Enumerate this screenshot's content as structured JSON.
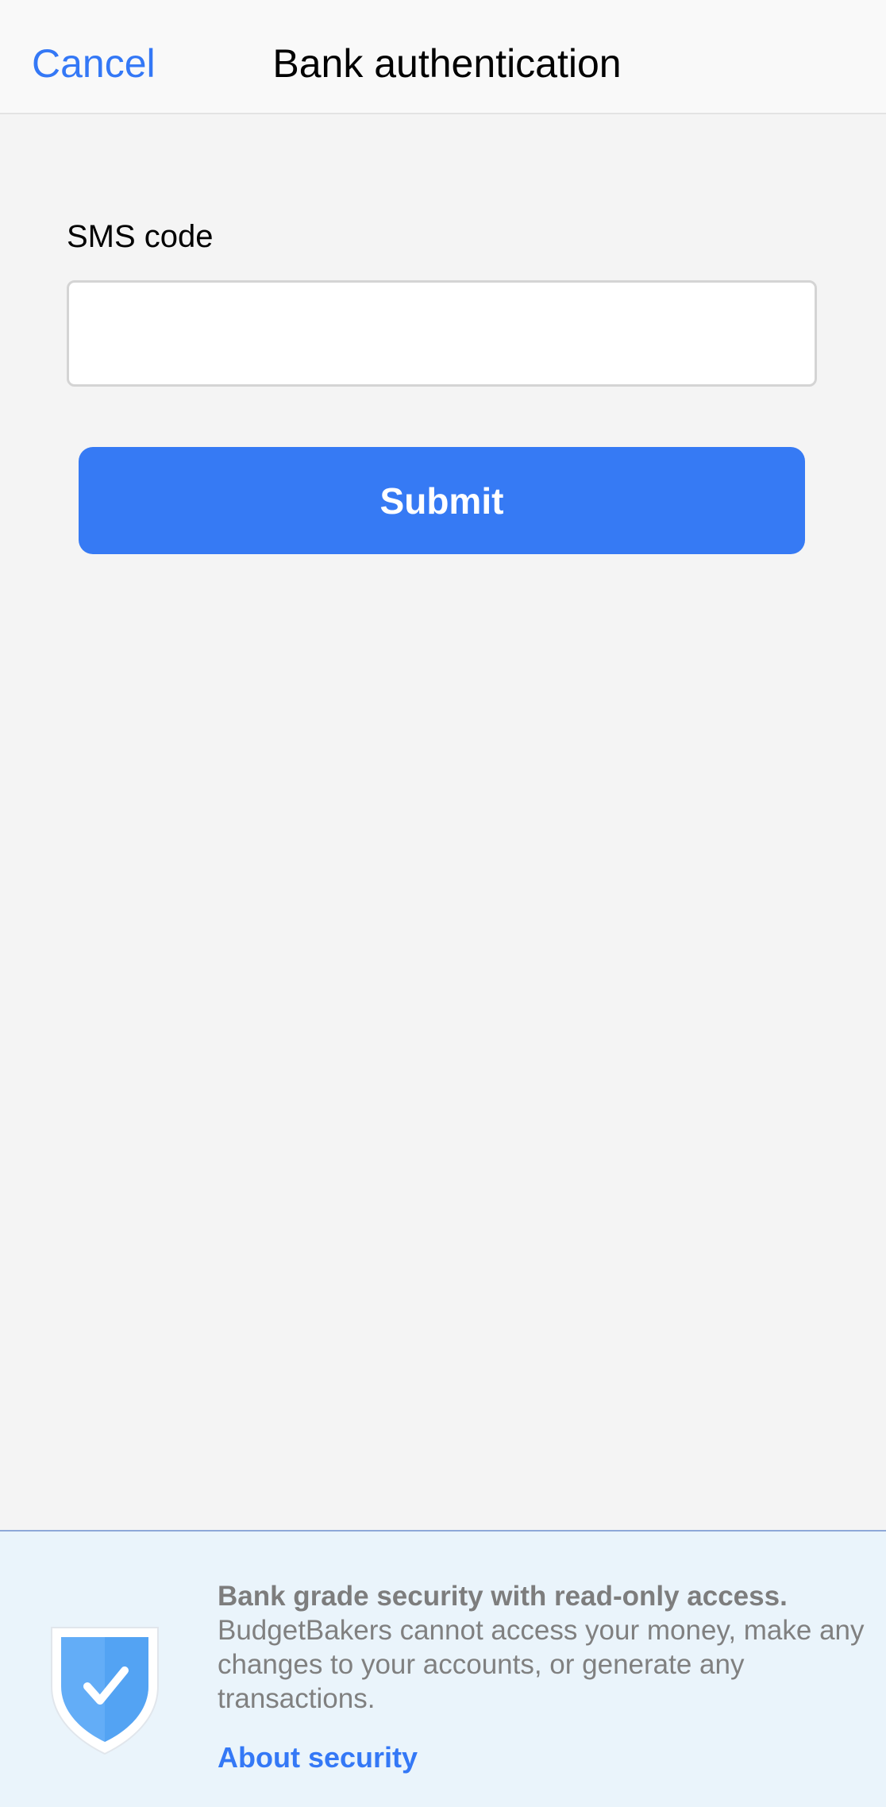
{
  "nav": {
    "cancel_label": "Cancel",
    "title": "Bank authentication"
  },
  "form": {
    "sms_label": "SMS code",
    "sms_value": "",
    "sms_placeholder": "",
    "submit_label": "Submit"
  },
  "security": {
    "icon": "shield-check-icon",
    "heading": "Bank grade security with read-only access.",
    "body": "BudgetBakers cannot access your money, make any changes to your accounts, or generate any transactions.",
    "link_label": "About security"
  },
  "colors": {
    "accent": "#3478f6",
    "button": "#367af4",
    "background": "#f4f4f4",
    "panel": "#eaf4fb"
  }
}
